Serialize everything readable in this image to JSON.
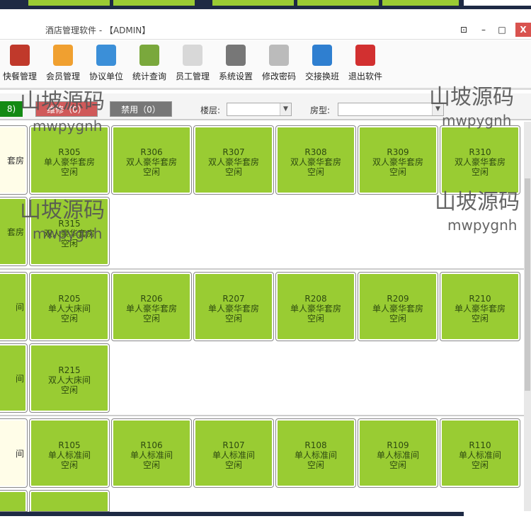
{
  "window": {
    "title": "酒店管理软件 - 【ADMIN】",
    "restore": "⊡",
    "minimize": "–",
    "maximize": "□",
    "close": "X"
  },
  "toolbar": [
    {
      "label": "快餐管理",
      "icon": "fastfood-icon",
      "color": "#c0392b"
    },
    {
      "label": "会员管理",
      "icon": "member-icon",
      "color": "#f0a030"
    },
    {
      "label": "协议单位",
      "icon": "agreement-icon",
      "color": "#3b8fd8"
    },
    {
      "label": "统计查询",
      "icon": "statistics-icon",
      "color": "#7aa83c"
    },
    {
      "label": "员工管理",
      "icon": "staff-icon",
      "color": "#d8d8d8"
    },
    {
      "label": "系统设置",
      "icon": "settings-icon",
      "color": "#777777"
    },
    {
      "label": "修改密码",
      "icon": "keys-icon",
      "color": "#bbbbbb"
    },
    {
      "label": "交接换班",
      "icon": "shift-icon",
      "color": "#2f7fd0"
    },
    {
      "label": "退出软件",
      "icon": "exit-icon",
      "color": "#d23030"
    }
  ],
  "filter": {
    "free_partial": "8)",
    "repair": "维修（0）",
    "disabled": "禁用（0）",
    "floor_label": "楼层:",
    "floor_value": "",
    "type_label": "房型:",
    "type_value": ""
  },
  "rooms": [
    {
      "row": 0,
      "col": 0,
      "partial": "套房",
      "occ": true
    },
    {
      "row": 0,
      "col": 1,
      "no": "R305",
      "type": "单人豪华套房",
      "status": "空闲"
    },
    {
      "row": 0,
      "col": 2,
      "no": "R306",
      "type": "双人豪华套房",
      "status": "空闲"
    },
    {
      "row": 0,
      "col": 3,
      "no": "R307",
      "type": "双人豪华套房",
      "status": "空闲"
    },
    {
      "row": 0,
      "col": 4,
      "no": "R308",
      "type": "双人豪华套房",
      "status": "空闲"
    },
    {
      "row": 0,
      "col": 5,
      "no": "R309",
      "type": "双人豪华套房",
      "status": "空闲"
    },
    {
      "row": 0,
      "col": 6,
      "no": "R310",
      "type": "双人豪华套房",
      "status": "空闲"
    },
    {
      "row": 1,
      "col": 0,
      "partial": "套房"
    },
    {
      "row": 1,
      "col": 1,
      "no": "R315",
      "type": "双人豪华套房",
      "status": "空闲"
    },
    {
      "row": 2,
      "col": 0,
      "partial": "间"
    },
    {
      "row": 2,
      "col": 1,
      "no": "R205",
      "type": "单人大床间",
      "status": "空闲"
    },
    {
      "row": 2,
      "col": 2,
      "no": "R206",
      "type": "单人豪华套房",
      "status": "空闲"
    },
    {
      "row": 2,
      "col": 3,
      "no": "R207",
      "type": "单人豪华套房",
      "status": "空闲"
    },
    {
      "row": 2,
      "col": 4,
      "no": "R208",
      "type": "单人豪华套房",
      "status": "空闲"
    },
    {
      "row": 2,
      "col": 5,
      "no": "R209",
      "type": "单人豪华套房",
      "status": "空闲"
    },
    {
      "row": 2,
      "col": 6,
      "no": "R210",
      "type": "单人豪华套房",
      "status": "空闲"
    },
    {
      "row": 3,
      "col": 0,
      "partial": "间"
    },
    {
      "row": 3,
      "col": 1,
      "no": "R215",
      "type": "双人大床间",
      "status": "空闲"
    },
    {
      "row": 4,
      "col": 0,
      "partial": "间",
      "occ": true
    },
    {
      "row": 4,
      "col": 1,
      "no": "R105",
      "type": "单人标准间",
      "status": "空闲"
    },
    {
      "row": 4,
      "col": 2,
      "no": "R106",
      "type": "单人标准间",
      "status": "空闲"
    },
    {
      "row": 4,
      "col": 3,
      "no": "R107",
      "type": "单人标准间",
      "status": "空闲"
    },
    {
      "row": 4,
      "col": 4,
      "no": "R108",
      "type": "单人标准间",
      "status": "空闲"
    },
    {
      "row": 4,
      "col": 5,
      "no": "R109",
      "type": "单人标准间",
      "status": "空闲"
    },
    {
      "row": 4,
      "col": 6,
      "no": "R110",
      "type": "单人标准间",
      "status": "空闲"
    },
    {
      "row": 5,
      "col": 0
    },
    {
      "row": 5,
      "col": 1
    }
  ],
  "watermark": {
    "cn": "山坡源码",
    "en": "mwpygnh"
  }
}
